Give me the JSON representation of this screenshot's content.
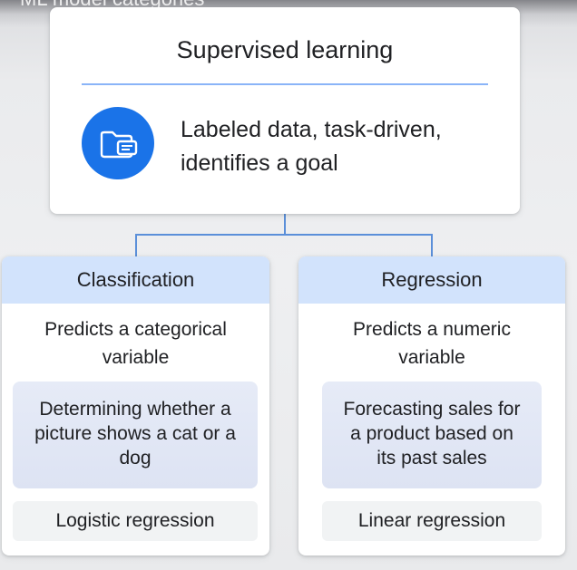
{
  "clipped_title": "ML model categories",
  "root": {
    "title": "Supervised learning",
    "icon": "folder-icon",
    "description_line1": "Labeled data, task-driven,",
    "description_line2": "identifies a goal"
  },
  "branches": [
    {
      "title": "Classification",
      "definition_line1": "Predicts a categorical",
      "definition_line2": "variable",
      "example_lines": [
        "Determining whether a",
        "picture shows a cat or a",
        "dog"
      ],
      "algorithm": "Logistic regression"
    },
    {
      "title": "Regression",
      "definition_line1": "Predicts a numeric",
      "definition_line2": "variable",
      "example_lines": [
        "Forecasting sales for",
        "a product based on",
        "its past sales"
      ],
      "algorithm": "Linear regression"
    }
  ],
  "colors": {
    "accent": "#1a73e8",
    "rule": "#8ab4f8",
    "header_fill": "#d2e3fc",
    "connector": "#5b8fd9"
  }
}
